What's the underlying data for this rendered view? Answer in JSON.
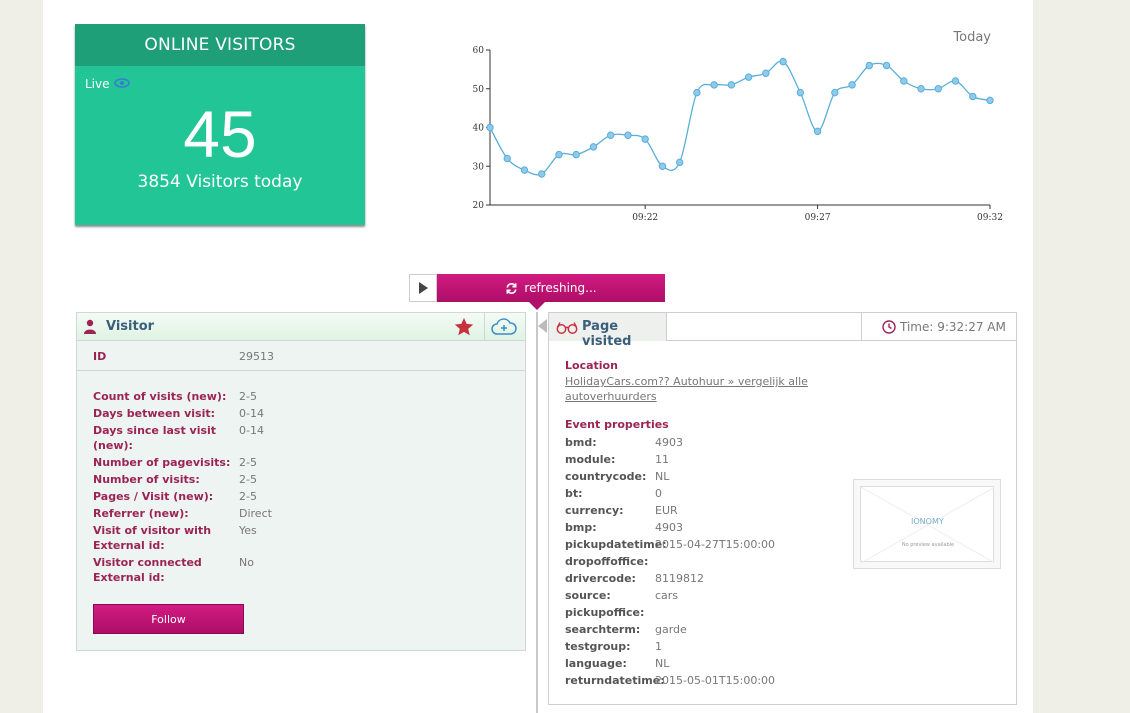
{
  "online_visitors": {
    "title": "ONLINE VISITORS",
    "live_label": "Live",
    "count": "45",
    "today_text": "3854 Visitors today"
  },
  "chart_data": {
    "type": "line",
    "title": "Today",
    "xlabel": "",
    "ylabel": "",
    "ylim": [
      20,
      60
    ],
    "yticks": [
      20,
      30,
      40,
      50,
      60
    ],
    "xtick_labels": [
      "09:22",
      "09:27",
      "09:32"
    ],
    "xtick_index": [
      9,
      19,
      29
    ],
    "grid": false,
    "series": [
      {
        "values": [
          40,
          32,
          29,
          28,
          33,
          33,
          35,
          38,
          38,
          37,
          30,
          31,
          49,
          51,
          51,
          53,
          54,
          57,
          49,
          39,
          49,
          51,
          56,
          56,
          52,
          50,
          50,
          52,
          48,
          47
        ]
      }
    ]
  },
  "refresh": {
    "label": "refreshing..."
  },
  "visitor": {
    "title": "Visitor",
    "id_label": "ID",
    "id_value": "29513",
    "rows": [
      {
        "label": "Count of visits (new):",
        "value": "2-5"
      },
      {
        "label": "Days between visit:",
        "value": "0-14"
      },
      {
        "label": "Days since last visit (new):",
        "value": "0-14"
      },
      {
        "label": "Number of pagevisits:",
        "value": "2-5"
      },
      {
        "label": "Number of visits:",
        "value": "2-5"
      },
      {
        "label": "Pages / Visit (new):",
        "value": "2-5"
      },
      {
        "label": "Referrer (new):",
        "value": "Direct"
      },
      {
        "label": "Visit of visitor with External id:",
        "value": "Yes"
      },
      {
        "label": "Visitor connected External id:",
        "value": "No"
      }
    ],
    "follow_label": "Follow"
  },
  "page_visited": {
    "title": "Page visited",
    "time": "Time: 9:32:27 AM",
    "location_label": "Location",
    "location_link": "HolidayCars.com?? Autohuur » vergelijk alle autoverhuurders",
    "event_label": "Event properties",
    "props": [
      {
        "label": "bmd:",
        "value": "4903"
      },
      {
        "label": "module:",
        "value": "11"
      },
      {
        "label": "countrycode:",
        "value": "NL"
      },
      {
        "label": "bt:",
        "value": "0"
      },
      {
        "label": "currency:",
        "value": "EUR"
      },
      {
        "label": "bmp:",
        "value": "4903"
      },
      {
        "label": "pickupdatetime:",
        "value": "2015-04-27T15:00:00"
      },
      {
        "label": "dropoffoffice:",
        "value": ""
      },
      {
        "label": "drivercode:",
        "value": "8119812"
      },
      {
        "label": "source:",
        "value": "cars"
      },
      {
        "label": "pickupoffice:",
        "value": ""
      },
      {
        "label": "searchterm:",
        "value": "garde"
      },
      {
        "label": "testgroup:",
        "value": "1"
      },
      {
        "label": "language:",
        "value": "NL"
      },
      {
        "label": "returndatetime:",
        "value": "2015-05-01T15:00:00"
      }
    ],
    "preview_logo": "IONOMY",
    "preview_text": "No preview available"
  },
  "colors": {
    "green": "#22c595",
    "green_dark": "#1f9f78",
    "magenta": "#c0137a",
    "line": "#5aaedb"
  }
}
